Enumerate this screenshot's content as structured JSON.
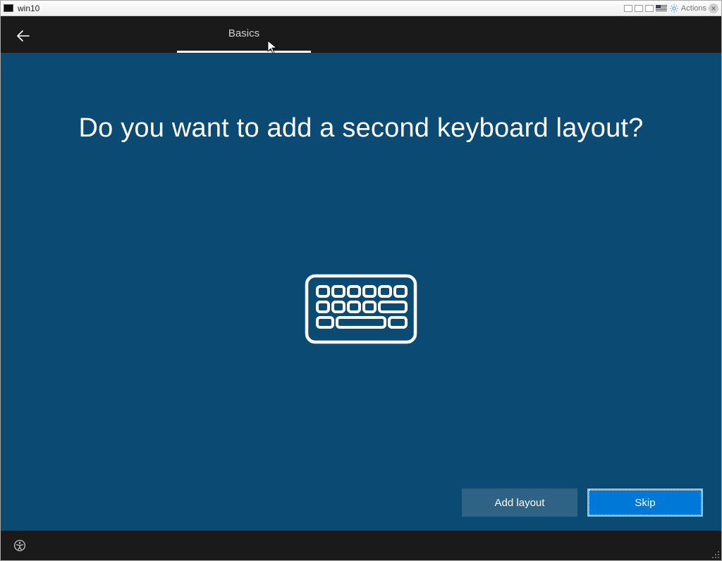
{
  "vm": {
    "window_title": "win10",
    "actions_label": "Actions"
  },
  "oobe": {
    "tab_label": "Basics",
    "question": "Do you want to add a second keyboard layout?",
    "buttons": {
      "add_layout": "Add layout",
      "skip": "Skip"
    }
  }
}
